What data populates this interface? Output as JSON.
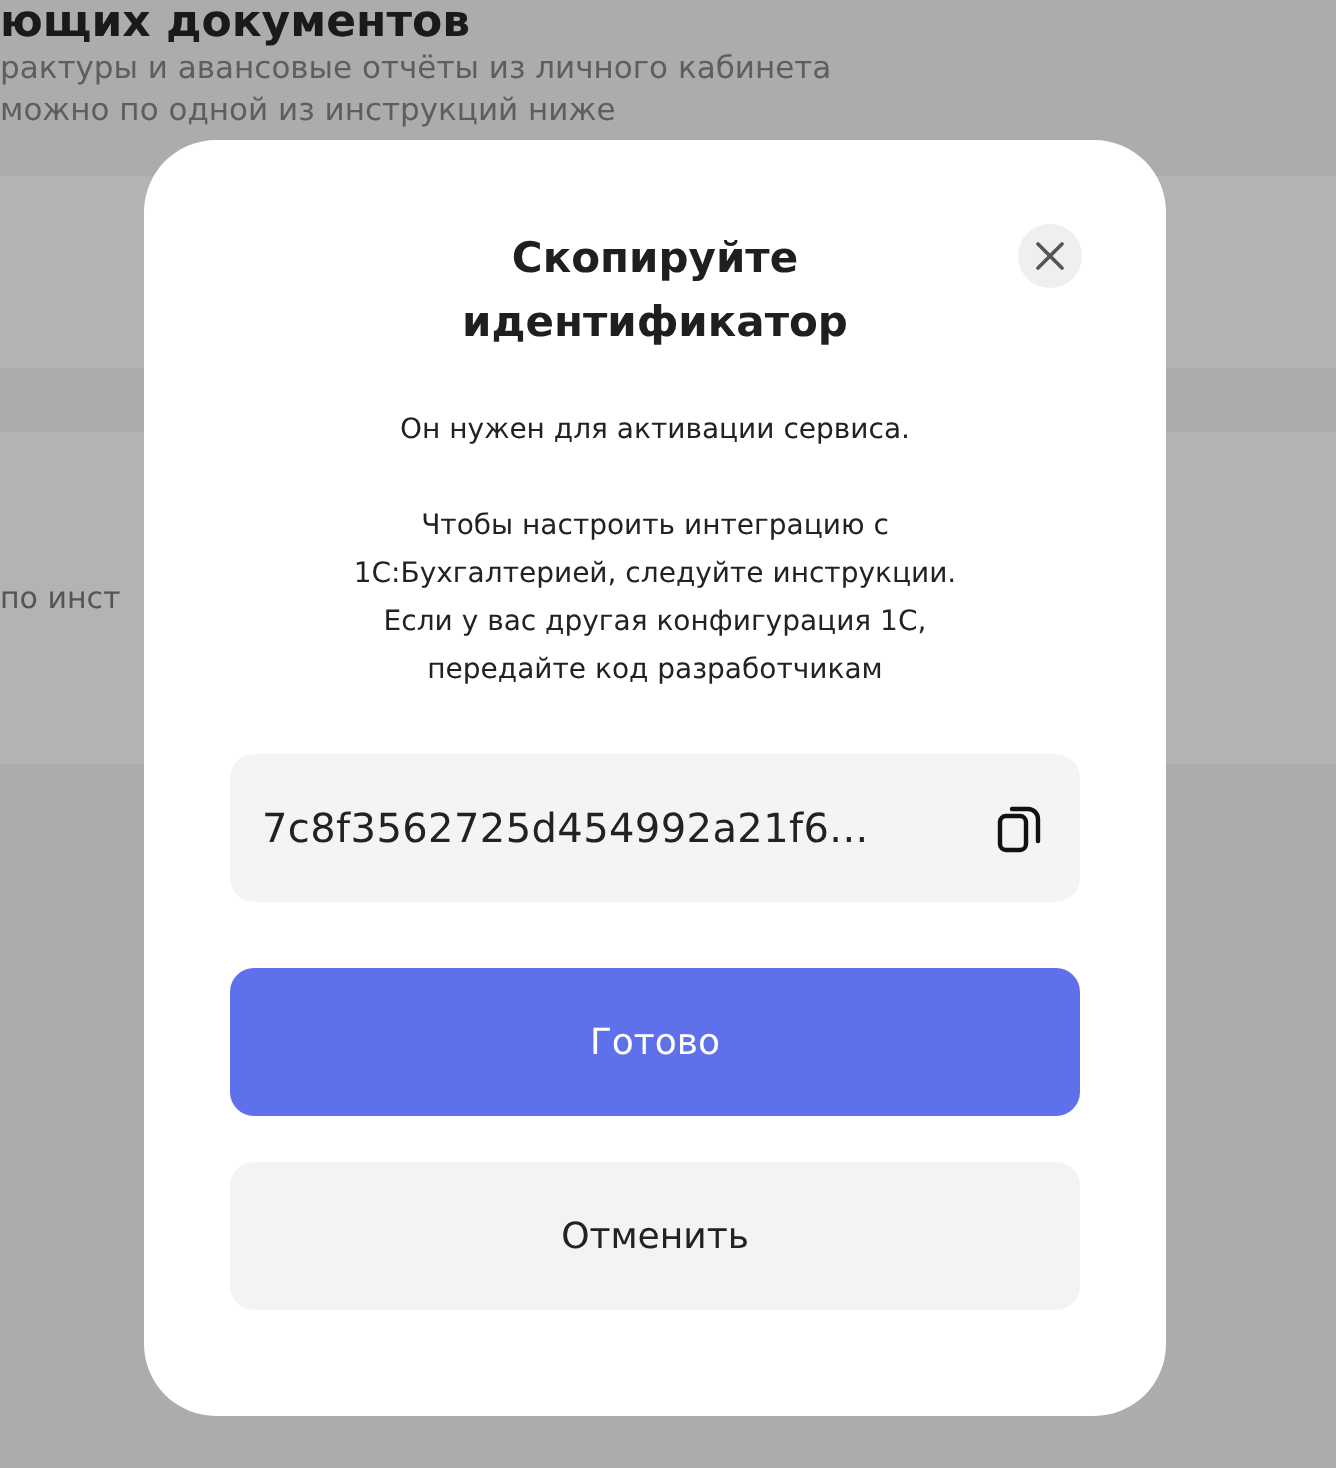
{
  "background": {
    "heading": "ющих документов",
    "lines": [
      "рактуры и авансовые отчёты из личного кабинета",
      "можно по одной из инструкций ниже"
    ],
    "card_text": "по инст"
  },
  "modal": {
    "title": "Скопируйте идентификатор",
    "paragraphs": [
      "Он нужен для активации сервиса.",
      "Чтобы настроить интеграцию с 1С:Бухгалтерией, следуйте инструкции. Если у вас другая конфигурация 1С, передайте код разработчикам"
    ],
    "identifier": "7c8f3562725d454992a21f6...",
    "buttons": [
      {
        "label": "Готово",
        "kind": "primary"
      },
      {
        "label": "Отменить",
        "kind": "secondary"
      }
    ]
  }
}
